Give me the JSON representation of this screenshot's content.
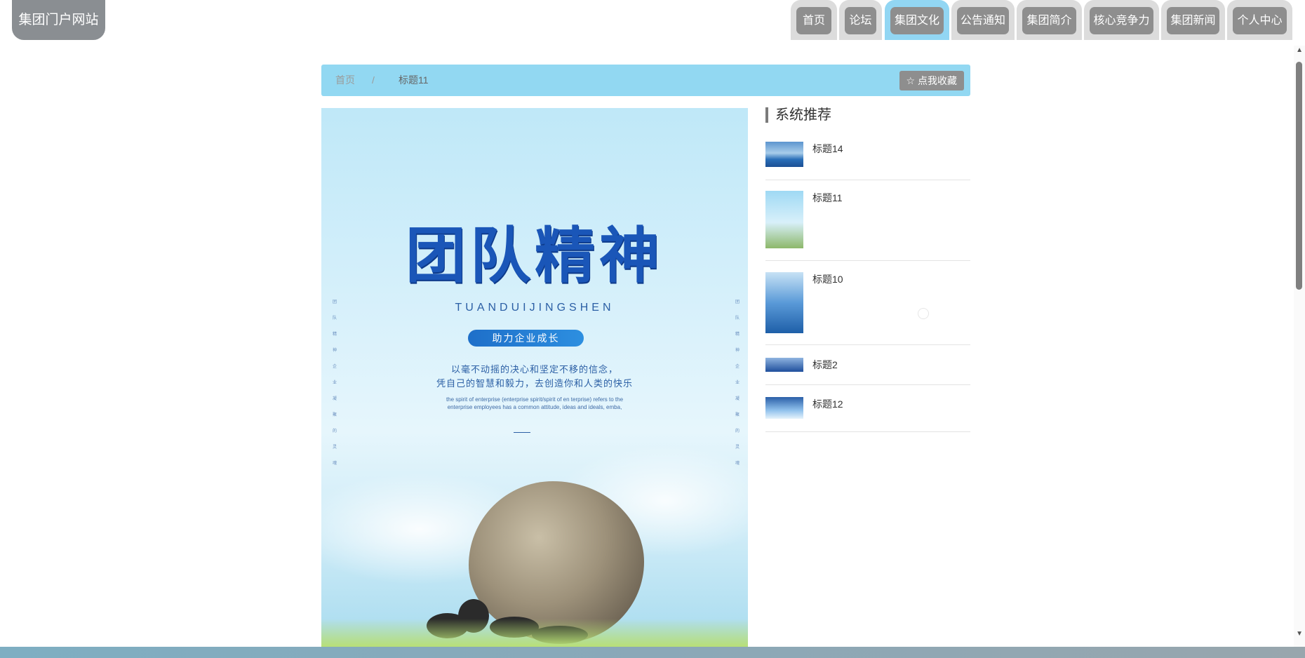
{
  "site": {
    "logo_text": "集团门户网站"
  },
  "nav": {
    "items": [
      {
        "label": "首页",
        "active": false
      },
      {
        "label": "论坛",
        "active": false
      },
      {
        "label": "集团文化",
        "active": true
      },
      {
        "label": "公告通知",
        "active": false
      },
      {
        "label": "集团简介",
        "active": false
      },
      {
        "label": "核心竞争力",
        "active": false
      },
      {
        "label": "集团新闻",
        "active": false
      },
      {
        "label": "个人中心",
        "active": false
      }
    ]
  },
  "breadcrumb": {
    "home": "首页",
    "separator": "/",
    "current": "标题11",
    "favorite_label": "☆ 点我收藏"
  },
  "poster": {
    "title": "团队精神",
    "pinyin": "TUANDUIJINGSHEN",
    "pill": "助力企业成长",
    "line1": "以毫不动摇的决心和坚定不移的信念，",
    "line2": "凭自己的智慧和毅力，去创造你和人类的快乐",
    "english": "the spirit of enterprise (enterprise spirit/spirit of en terprise) refers to the enterprise employees has a common attitude, ideas and ideals, emba,",
    "vertical_left": "团 队 精 神 企 业 凝 聚 的 灵 魂",
    "vertical_right": "团 队 精 神 企 业 凝 聚 的 灵 魂"
  },
  "sidebar": {
    "title": "系统推荐",
    "items": [
      {
        "title": "标题14"
      },
      {
        "title": "标题11"
      },
      {
        "title": "标题10"
      },
      {
        "title": "标题2"
      },
      {
        "title": "标题12"
      }
    ]
  },
  "colors": {
    "accent": "#92d8f2",
    "button_gray": "#8e8e8e",
    "tab_border": "#dcdcdc",
    "poster_blue": "#1a56b8"
  }
}
